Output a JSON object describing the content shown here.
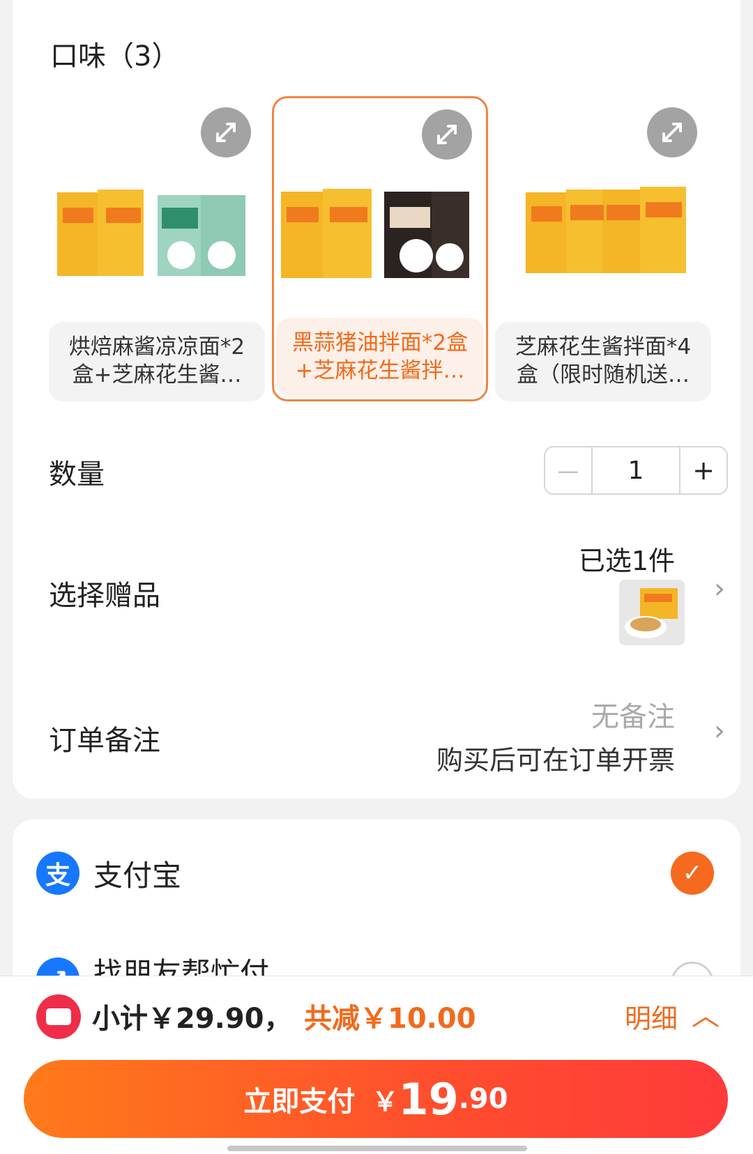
{
  "flavor": {
    "title": "口味（3）",
    "variants": [
      {
        "label": "烘焙麻酱凉凉面*2盒+芝麻花生酱…",
        "selected": false
      },
      {
        "label": "黑蒜猪油拌面*2盒+芝麻花生酱拌…",
        "selected": true
      },
      {
        "label": "芝麻花生酱拌面*4盒（限时随机送…",
        "selected": false
      }
    ]
  },
  "quantity": {
    "label": "数量",
    "minus": "－",
    "value": "1",
    "plus": "+"
  },
  "gift": {
    "label": "选择赠品",
    "count": "已选1件"
  },
  "remark": {
    "label": "订单备注",
    "placeholder": "无备注",
    "note": "购买后可在订单开票"
  },
  "payment": {
    "methods": [
      {
        "name": "支付宝",
        "icon": "alipay-icon",
        "checked": true
      },
      {
        "name": "找朋友帮忙付",
        "checked": false
      }
    ]
  },
  "summary": {
    "subtotal": "小计￥29.90，",
    "discount": "共减￥10.00",
    "detail": "明细"
  },
  "pay_button": {
    "label": "立即支付",
    "yen": "￥",
    "amount_int": "19",
    "amount_dec": ".90"
  },
  "colors": {
    "accent": "#f26a1b",
    "alipay": "#1677ff",
    "coupon": "#f02d49"
  }
}
